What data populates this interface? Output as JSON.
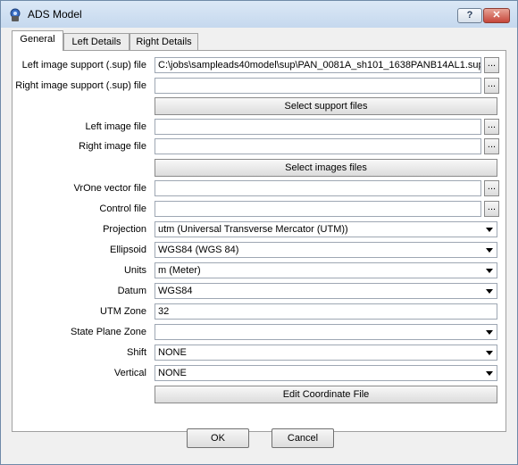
{
  "window": {
    "title": "ADS Model",
    "help_label": "?",
    "close_label": "✕"
  },
  "tabs": [
    "General",
    "Left Details",
    "Right Details"
  ],
  "fields": {
    "left_support": {
      "label": "Left image support (.sup) file",
      "value": "C:\\jobs\\sampleads40model\\sup\\PAN_0081A_sh101_1638PANB14AL1.sup"
    },
    "right_support": {
      "label": "Right image support (.sup) file",
      "value": ""
    },
    "left_image": {
      "label": "Left image file",
      "value": ""
    },
    "right_image": {
      "label": "Right image file",
      "value": ""
    },
    "vrone_vector": {
      "label": "VrOne vector file",
      "value": ""
    },
    "control_file": {
      "label": "Control file",
      "value": ""
    },
    "projection": {
      "label": "Projection",
      "value": "utm (Universal Transverse Mercator (UTM))"
    },
    "ellipsoid": {
      "label": "Ellipsoid",
      "value": "WGS84 (WGS 84)"
    },
    "units": {
      "label": "Units",
      "value": "m (Meter)"
    },
    "datum": {
      "label": "Datum",
      "value": "WGS84"
    },
    "utm_zone": {
      "label": "UTM Zone",
      "value": "32"
    },
    "state_plane": {
      "label": "State Plane Zone",
      "value": ""
    },
    "shift": {
      "label": "Shift",
      "value": "NONE"
    },
    "vertical": {
      "label": "Vertical",
      "value": "NONE"
    }
  },
  "buttons": {
    "browse": "...",
    "select_support": "Select support files",
    "select_images": "Select images files",
    "edit_coordinate": "Edit Coordinate File",
    "ok": "OK",
    "cancel": "Cancel"
  }
}
